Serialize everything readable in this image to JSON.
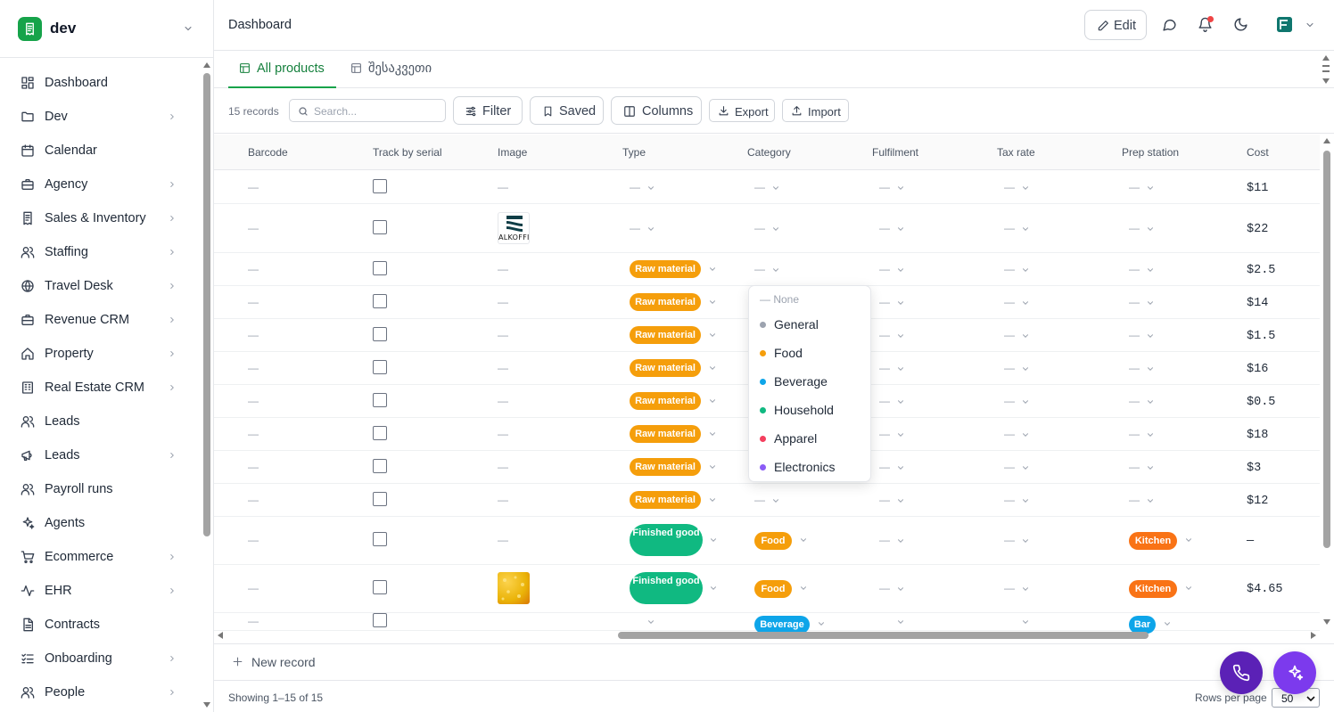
{
  "workspace": {
    "name": "dev"
  },
  "sidebar": {
    "items": [
      {
        "label": "Dashboard",
        "icon": "dashboard-icon",
        "chevron": false
      },
      {
        "label": "Dev",
        "icon": "folder-icon",
        "chevron": true
      },
      {
        "label": "Calendar",
        "icon": "calendar-icon",
        "chevron": false
      },
      {
        "label": "Agency",
        "icon": "briefcase-icon",
        "chevron": true
      },
      {
        "label": "Sales & Inventory",
        "icon": "receipt-icon",
        "chevron": true
      },
      {
        "label": "Staffing",
        "icon": "users-icon",
        "chevron": true
      },
      {
        "label": "Travel Desk",
        "icon": "globe-icon",
        "chevron": true
      },
      {
        "label": "Revenue CRM",
        "icon": "briefcase-icon",
        "chevron": true
      },
      {
        "label": "Property",
        "icon": "home-icon",
        "chevron": true
      },
      {
        "label": "Real Estate CRM",
        "icon": "building-icon",
        "chevron": true
      },
      {
        "label": "Leads",
        "icon": "users-icon",
        "chevron": false
      },
      {
        "label": "Leads",
        "icon": "megaphone-icon",
        "chevron": true
      },
      {
        "label": "Payroll runs",
        "icon": "users-icon",
        "chevron": false
      },
      {
        "label": "Agents",
        "icon": "sparkles-icon",
        "chevron": false
      },
      {
        "label": "Ecommerce",
        "icon": "cart-icon",
        "chevron": true
      },
      {
        "label": "EHR",
        "icon": "activity-icon",
        "chevron": true
      },
      {
        "label": "Contracts",
        "icon": "document-icon",
        "chevron": false
      },
      {
        "label": "Onboarding",
        "icon": "checklist-icon",
        "chevron": true
      },
      {
        "label": "People",
        "icon": "users-icon",
        "chevron": true
      }
    ]
  },
  "header": {
    "title": "Dashboard",
    "edit_label": "Edit"
  },
  "tabs": [
    {
      "label": "All products",
      "active": true
    },
    {
      "label": "შესაკვეთი",
      "active": false
    }
  ],
  "toolbar": {
    "record_count": "15 records",
    "search_placeholder": "Search...",
    "filter_label": "Filter",
    "saved_label": "Saved",
    "columns_label": "Columns",
    "export_label": "Export",
    "import_label": "Import"
  },
  "table": {
    "columns": [
      "Barcode",
      "Track by serial",
      "Image",
      "Type",
      "Category",
      "Fulfilment",
      "Tax rate",
      "Prep station",
      "Cost"
    ],
    "empty": "—",
    "rows": [
      {
        "type": null,
        "category": null,
        "prep": null,
        "cost": "$11",
        "image": null
      },
      {
        "type": null,
        "category": null,
        "prep": null,
        "cost": "$22",
        "image": "alkoffic"
      },
      {
        "type": "Raw material",
        "category": null,
        "prep": null,
        "cost": "$2.5",
        "image": null
      },
      {
        "type": "Raw material",
        "category": null,
        "prep": null,
        "cost": "$14",
        "image": null
      },
      {
        "type": "Raw material",
        "category": null,
        "prep": null,
        "cost": "$1.5",
        "image": null
      },
      {
        "type": "Raw material",
        "category": null,
        "prep": null,
        "cost": "$16",
        "image": null
      },
      {
        "type": "Raw material",
        "category": null,
        "prep": null,
        "cost": "$0.5",
        "image": null
      },
      {
        "type": "Raw material",
        "category": null,
        "prep": null,
        "cost": "$18",
        "image": null
      },
      {
        "type": "Raw material",
        "category": null,
        "prep": null,
        "cost": "$3",
        "image": null
      },
      {
        "type": "Raw material",
        "category": null,
        "prep": null,
        "cost": "$12",
        "image": null
      },
      {
        "type": "Finished good",
        "category": "Food",
        "prep": "Kitchen",
        "cost": "—",
        "image": null
      },
      {
        "type": "Finished good",
        "category": "Food",
        "prep": "Kitchen",
        "cost": "$4.65",
        "image": "food"
      },
      {
        "type": null,
        "category": "Beverage",
        "prep": "Bar",
        "cost": "",
        "image": null
      }
    ],
    "alkoffic_text": "ALKOFFIC"
  },
  "category_popover": {
    "none_label": "— None",
    "options": [
      {
        "label": "General",
        "color": "#9ca3af"
      },
      {
        "label": "Food",
        "color": "#f59e0b"
      },
      {
        "label": "Beverage",
        "color": "#0ea5e9"
      },
      {
        "label": "Household",
        "color": "#10b981"
      },
      {
        "label": "Apparel",
        "color": "#f43f5e"
      },
      {
        "label": "Electronics",
        "color": "#8b5cf6"
      }
    ]
  },
  "new_record_label": "New record",
  "footer": {
    "showing": "Showing 1–15 of 15",
    "rows_per_page_label": "Rows per page",
    "rows_per_page": "50"
  },
  "colors": {
    "accent": "#16a34a",
    "raw_material": "#f59e0b",
    "finished_good": "#10b981",
    "food": "#f59e0b",
    "kitchen": "#f97316",
    "beverage": "#0ea5e9",
    "bar": "#0ea5e9",
    "fab": "#6d28d9"
  }
}
